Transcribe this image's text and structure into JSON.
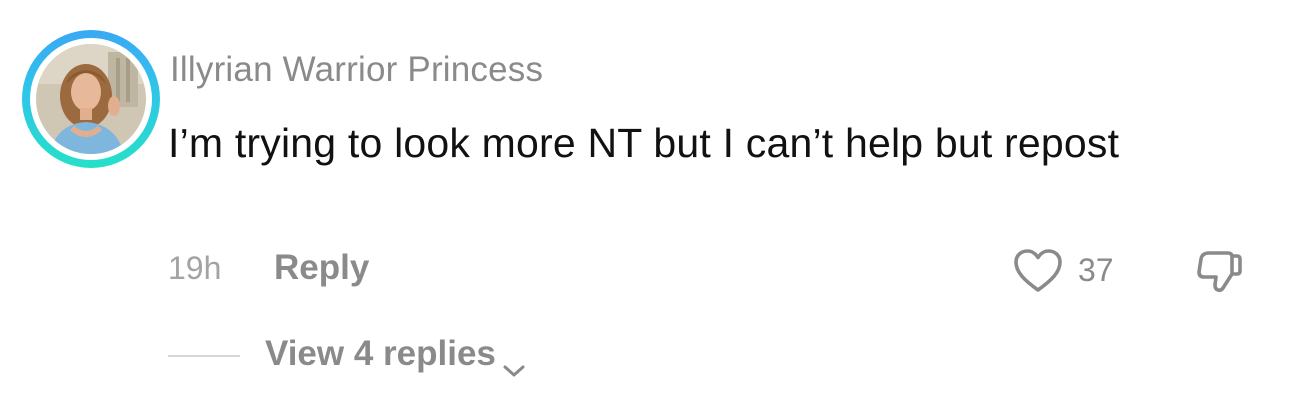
{
  "comment": {
    "username": "Illyrian Warrior Princess",
    "text": "I’m trying to look more NT but I can’t help but repost",
    "timestamp": "19h",
    "reply_label": "Reply",
    "like_count": "37",
    "view_replies_label": "View 4 replies"
  },
  "icons": {
    "like": "heart-outline-icon",
    "dislike": "thumbs-down-outline-icon",
    "expand": "chevron-down-icon"
  },
  "colors": {
    "avatar_ring_top": "#3aa8f5",
    "avatar_ring_bottom": "#25e0c8",
    "secondary_text": "#8a8a8a",
    "primary_text": "#111111"
  }
}
